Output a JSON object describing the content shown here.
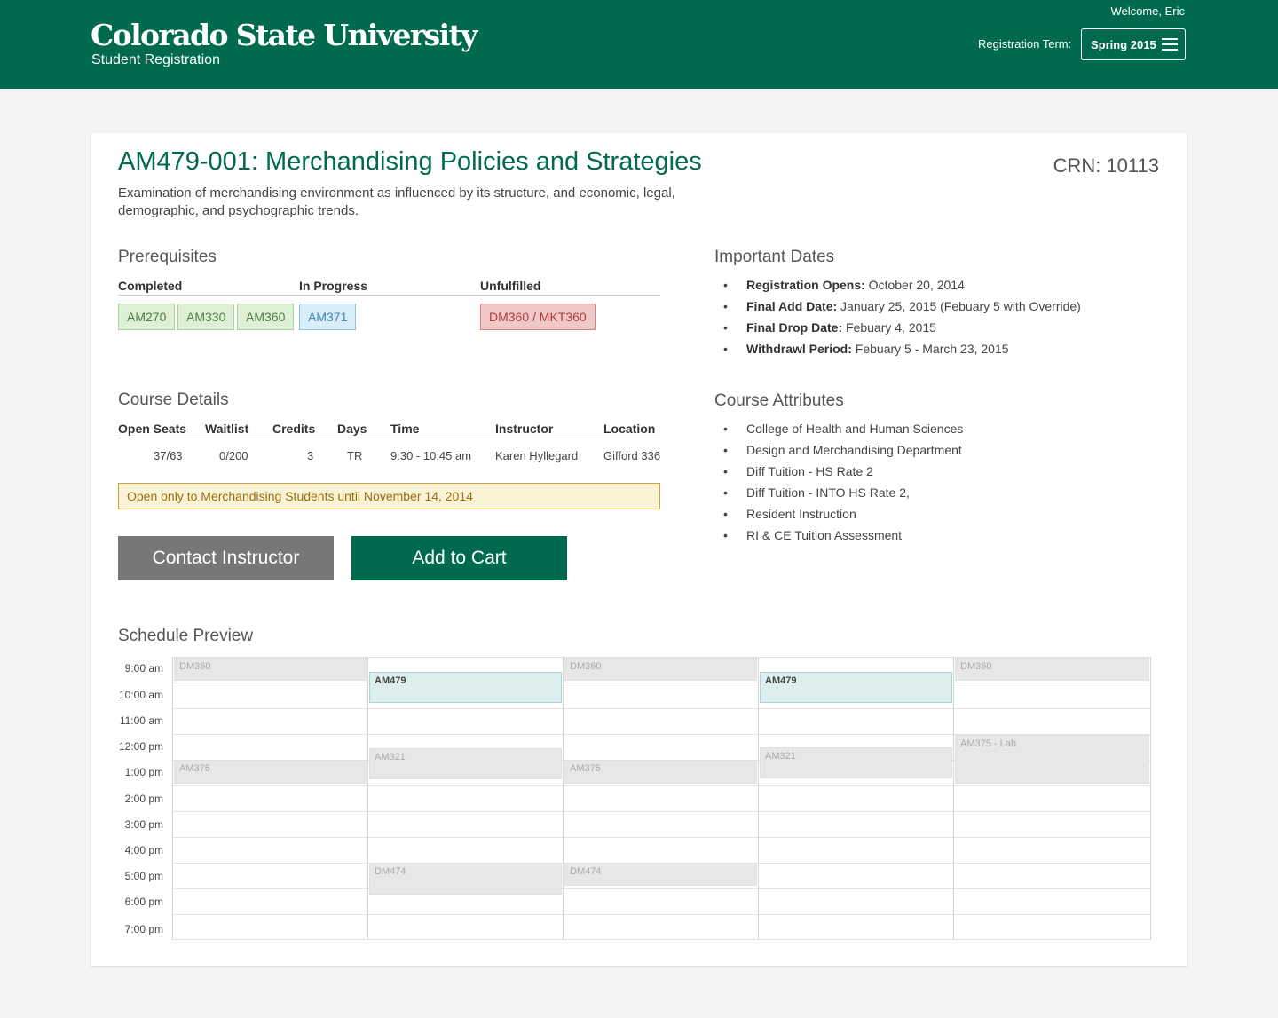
{
  "header": {
    "logo_main": "Colorado State University",
    "logo_sub": "Student Registration",
    "welcome": "Welcome, Eric",
    "term_label": "Registration Term:",
    "term_value": "Spring 2015",
    "brand_color": "#006a4e"
  },
  "course": {
    "code": "AM479-001",
    "title": ": Merchandising Policies and Strategies",
    "crn": "CRN: 10113",
    "description": "Examination of merchandising environment as influenced by its structure, and economic, legal, demographic, and psychographic trends."
  },
  "prerequisites": {
    "heading": "Prerequisites",
    "completed_label": "Completed",
    "in_progress_label": "In Progress",
    "unfulfilled_label": "Unfulfilled",
    "completed": [
      "AM270",
      "AM330",
      "AM360"
    ],
    "in_progress": [
      "AM371"
    ],
    "unfulfilled": [
      "DM360 / MKT360"
    ]
  },
  "important_dates": {
    "heading": "Important Dates",
    "items": [
      {
        "label": "Registration Opens:",
        "value": " October 20, 2014"
      },
      {
        "label": "Final Add Date:",
        "value": " January 25, 2015 (Febuary 5 with Override)"
      },
      {
        "label": "Final Drop Date:",
        "value": " Febuary 4, 2015"
      },
      {
        "label": "Withdrawl Period:",
        "value": " Febuary 5 - March 23, 2015"
      }
    ]
  },
  "course_details": {
    "heading": "Course Details",
    "columns": [
      "Open Seats",
      "Waitlist",
      "Credits",
      "Days",
      "Time",
      "Instructor",
      "Location"
    ],
    "values": [
      "37/63",
      "0/200",
      "3",
      "TR",
      "9:30 - 10:45 am",
      "Karen Hyllegard",
      "Gifford 336"
    ],
    "notice": "Open only to Merchandising Students until November 14, 2014"
  },
  "course_attributes": {
    "heading": "Course Attributes",
    "items": [
      "College of Health and Human Sciences",
      "Design and Merchandising Department",
      "Diff Tuition - HS Rate 2",
      "Diff Tuition - INTO HS Rate 2,",
      "Resident Instruction",
      "RI & CE Tuition Assessment"
    ]
  },
  "actions": {
    "contact_label": "Contact Instructor",
    "cart_label": "Add to Cart"
  },
  "schedule": {
    "heading": "Schedule Preview",
    "times": [
      "9:00 am",
      "10:00 am",
      "11:00 am",
      "12:00 pm",
      "1:00 pm",
      "2:00 pm",
      "3:00 pm",
      "4:00 pm",
      "5:00 pm",
      "6:00 pm",
      "7:00 pm"
    ],
    "blocks": [
      {
        "day": 0,
        "label": "DM360"
      },
      {
        "day": 0,
        "label": "AM375"
      },
      {
        "day": 1,
        "label": "AM479",
        "current": true
      },
      {
        "day": 1,
        "label": "AM321"
      },
      {
        "day": 1,
        "label": "DM474"
      },
      {
        "day": 2,
        "label": "DM360"
      },
      {
        "day": 2,
        "label": "AM375"
      },
      {
        "day": 2,
        "label": "DM474"
      },
      {
        "day": 3,
        "label": "AM479",
        "current": true
      },
      {
        "day": 3,
        "label": "AM321"
      },
      {
        "day": 4,
        "label": "DM360"
      },
      {
        "day": 4,
        "label": "AM375 - Lab"
      }
    ]
  }
}
